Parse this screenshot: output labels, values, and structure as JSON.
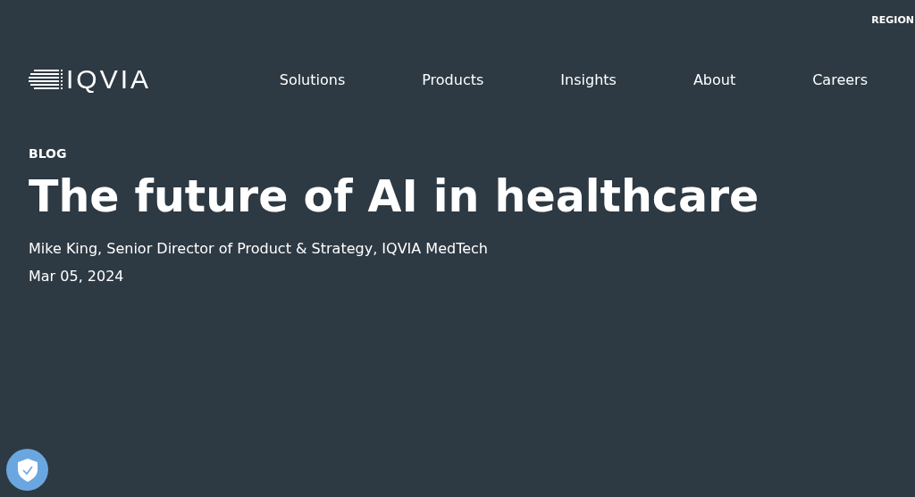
{
  "top_bar": {
    "region": "REGION"
  },
  "header": {
    "logo": "IQVIA",
    "nav": [
      {
        "label": "Solutions"
      },
      {
        "label": "Products"
      },
      {
        "label": "Insights"
      },
      {
        "label": "About"
      },
      {
        "label": "Careers"
      }
    ]
  },
  "article": {
    "category": "BLOG",
    "title": "The future of AI in healthcare",
    "author": "Mike King, Senior Director of Product & Strategy, IQVIA MedTech",
    "date": "Mar 05, 2024"
  }
}
